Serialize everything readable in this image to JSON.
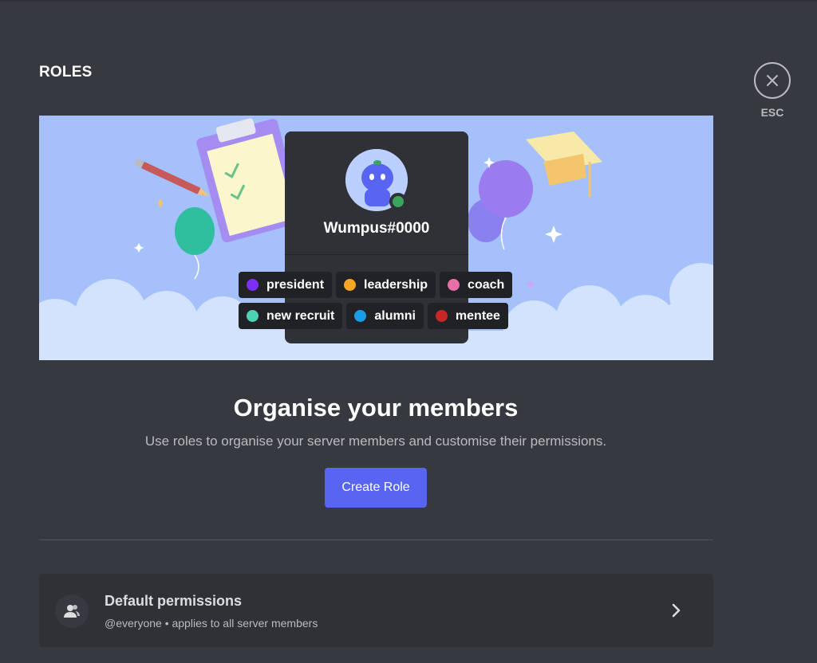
{
  "header": {
    "title": "ROLES"
  },
  "close": {
    "label": "ESC",
    "icon": "close-icon"
  },
  "banner": {
    "profile": {
      "username": "Wumpus#0000",
      "status_color": "#3ba55d"
    },
    "roles": [
      {
        "name": "president",
        "color": "#7b2ff7"
      },
      {
        "name": "leadership",
        "color": "#f5a623"
      },
      {
        "name": "coach",
        "color": "#e86fa8"
      },
      {
        "name": "new recruit",
        "color": "#4fd1b4"
      },
      {
        "name": "alumni",
        "color": "#1a9de6"
      },
      {
        "name": "mentee",
        "color": "#c62828"
      }
    ]
  },
  "main": {
    "heading": "Organise your members",
    "subtext": "Use roles to organise your server members and customise their permissions.",
    "create_button": "Create Role"
  },
  "default_permissions": {
    "title": "Default permissions",
    "subtitle": "@everyone • applies to all server members",
    "icon": "members-icon"
  },
  "colors": {
    "accent": "#5865f2",
    "background": "#36393f",
    "surface": "#2f3136"
  }
}
